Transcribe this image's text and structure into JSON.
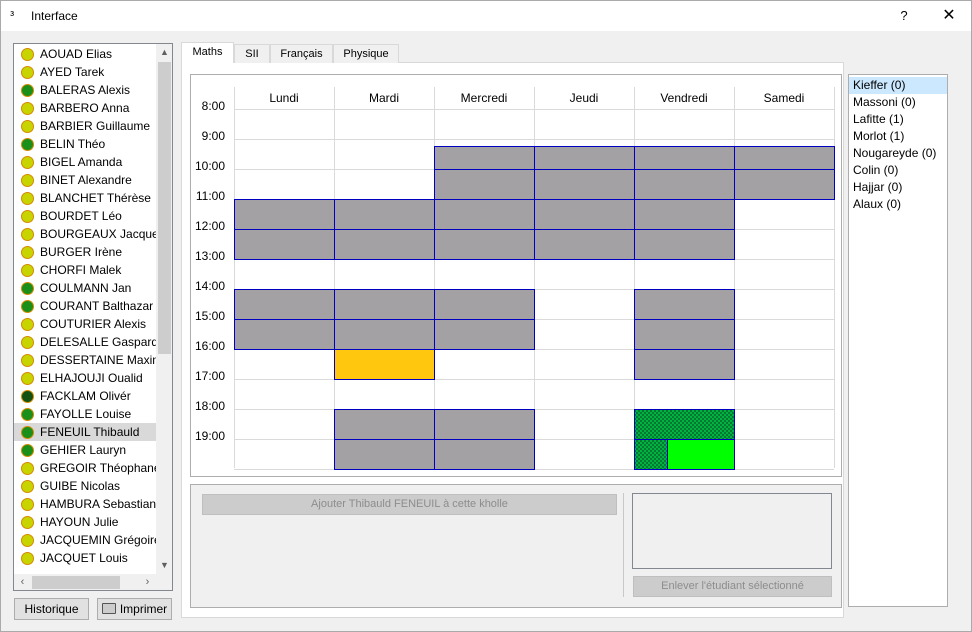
{
  "window": {
    "title": "Interface",
    "help": "?",
    "close": "✕",
    "app_icon": "app-icon"
  },
  "students": [
    {
      "name": "AOUAD Elias",
      "color": "#c8d400"
    },
    {
      "name": "AYED Tarek",
      "color": "#c8d400"
    },
    {
      "name": "BALERAS Alexis",
      "color": "#1a8f1a"
    },
    {
      "name": "BARBERO Anna",
      "color": "#c8d400"
    },
    {
      "name": "BARBIER Guillaume",
      "color": "#c8d400"
    },
    {
      "name": "BELIN Théo",
      "color": "#1a8f1a"
    },
    {
      "name": "BIGEL Amanda",
      "color": "#c8d400"
    },
    {
      "name": "BINET Alexandre",
      "color": "#c8d400"
    },
    {
      "name": "BLANCHET Thérèse",
      "color": "#c8d400"
    },
    {
      "name": "BOURDET Léo",
      "color": "#c8d400"
    },
    {
      "name": "BOURGEAUX Jacques",
      "color": "#c8d400"
    },
    {
      "name": "BURGER Irène",
      "color": "#c8d400"
    },
    {
      "name": "CHORFI Malek",
      "color": "#c8d400"
    },
    {
      "name": "COULMANN Jan",
      "color": "#1a8f1a"
    },
    {
      "name": "COURANT Balthazar",
      "color": "#1a8f1a"
    },
    {
      "name": "COUTURIER Alexis",
      "color": "#c8d400"
    },
    {
      "name": "DELESALLE Gaspard",
      "color": "#c8d400"
    },
    {
      "name": "DESSERTAINE Maxime",
      "color": "#c8d400"
    },
    {
      "name": "ELHAJOUJI Oualid",
      "color": "#c8d400"
    },
    {
      "name": "FACKLAM Olivér",
      "color": "#145214"
    },
    {
      "name": "FAYOLLE Louise",
      "color": "#1a8f1a"
    },
    {
      "name": "FENEUIL Thibauld",
      "color": "#1a8f1a",
      "selected": true
    },
    {
      "name": "GEHIER Lauryn",
      "color": "#1a8f1a"
    },
    {
      "name": "GREGOIR Théophane",
      "color": "#c8d400"
    },
    {
      "name": "GUIBE Nicolas",
      "color": "#c8d400"
    },
    {
      "name": "HAMBURA Sebastian",
      "color": "#c8d400"
    },
    {
      "name": "HAYOUN Julie",
      "color": "#c8d400"
    },
    {
      "name": "JACQUEMIN Grégoire",
      "color": "#c8d400"
    },
    {
      "name": "JACQUET Louis",
      "color": "#c8d400"
    }
  ],
  "buttons": {
    "historique": "Historique",
    "imprimer": "Imprimer"
  },
  "tabs": [
    {
      "label": "Maths",
      "active": true
    },
    {
      "label": "SII"
    },
    {
      "label": "Français"
    },
    {
      "label": "Physique"
    }
  ],
  "schedule": {
    "days": [
      "Lundi",
      "Mardi",
      "Mercredi",
      "Jeudi",
      "Vendredi",
      "Samedi"
    ],
    "hours": [
      "8:00",
      "9:00",
      "10:00",
      "11:00",
      "12:00",
      "13:00",
      "14:00",
      "15:00",
      "16:00",
      "17:00",
      "18:00",
      "19:00"
    ],
    "slots": [
      {
        "day": 2,
        "start": "9:00",
        "end": "10:00",
        "state": "taken"
      },
      {
        "day": 2,
        "start": "10:00",
        "end": "11:00",
        "state": "taken"
      },
      {
        "day": 3,
        "start": "9:00",
        "end": "10:00",
        "state": "taken"
      },
      {
        "day": 3,
        "start": "10:00",
        "end": "11:00",
        "state": "taken"
      },
      {
        "day": 4,
        "start": "9:00",
        "end": "10:00",
        "state": "taken"
      },
      {
        "day": 4,
        "start": "10:00",
        "end": "11:00",
        "state": "taken"
      },
      {
        "day": 5,
        "start": "9:00",
        "end": "10:00",
        "state": "taken"
      },
      {
        "day": 5,
        "start": "10:00",
        "end": "11:00",
        "state": "taken"
      },
      {
        "day": 0,
        "start": "11:00",
        "end": "12:00",
        "state": "taken"
      },
      {
        "day": 0,
        "start": "12:00",
        "end": "13:00",
        "state": "taken"
      },
      {
        "day": 1,
        "start": "11:00",
        "end": "12:00",
        "state": "taken"
      },
      {
        "day": 1,
        "start": "12:00",
        "end": "13:00",
        "state": "taken"
      },
      {
        "day": 2,
        "start": "11:00",
        "end": "12:00",
        "state": "taken"
      },
      {
        "day": 2,
        "start": "12:00",
        "end": "13:00",
        "state": "taken"
      },
      {
        "day": 3,
        "start": "11:00",
        "end": "12:00",
        "state": "taken"
      },
      {
        "day": 3,
        "start": "12:00",
        "end": "13:00",
        "state": "taken"
      },
      {
        "day": 4,
        "start": "11:00",
        "end": "12:00",
        "state": "taken"
      },
      {
        "day": 4,
        "start": "12:00",
        "end": "13:00",
        "state": "taken"
      },
      {
        "day": 0,
        "start": "14:00",
        "end": "15:00",
        "state": "taken"
      },
      {
        "day": 0,
        "start": "15:00",
        "end": "16:00",
        "state": "taken"
      },
      {
        "day": 1,
        "start": "14:00",
        "end": "15:00",
        "state": "taken"
      },
      {
        "day": 1,
        "start": "15:00",
        "end": "16:00",
        "state": "taken"
      },
      {
        "day": 2,
        "start": "14:00",
        "end": "15:00",
        "state": "taken"
      },
      {
        "day": 2,
        "start": "15:00",
        "end": "16:00",
        "state": "taken"
      },
      {
        "day": 4,
        "start": "14:00",
        "end": "15:00",
        "state": "taken"
      },
      {
        "day": 4,
        "start": "15:00",
        "end": "16:00",
        "state": "taken"
      },
      {
        "day": 4,
        "start": "16:00",
        "end": "17:00",
        "state": "taken"
      },
      {
        "day": 1,
        "start": "16:00",
        "end": "17:00",
        "state": "highlighted"
      },
      {
        "day": 1,
        "start": "18:00",
        "end": "19:00",
        "state": "taken"
      },
      {
        "day": 1,
        "start": "19:00",
        "end": "20:00",
        "state": "taken"
      },
      {
        "day": 2,
        "start": "18:00",
        "end": "19:00",
        "state": "taken"
      },
      {
        "day": 2,
        "start": "19:00",
        "end": "20:00",
        "state": "taken"
      },
      {
        "day": 4,
        "start": "18:00",
        "end": "19:00",
        "state": "assigned-hatched"
      },
      {
        "day": 4,
        "start": "19:00",
        "end": "20:00",
        "state": "assigned-hatched",
        "part": "left"
      },
      {
        "day": 4,
        "start": "19:00",
        "end": "20:00",
        "state": "assigned",
        "part": "right"
      }
    ],
    "colors": {
      "taken": "#a3a1a4",
      "highlighted": "#ffc70e",
      "assigned": "#00ff00",
      "assigned-hatched": "#00c040",
      "border": "#0000c0"
    }
  },
  "actions": {
    "add_label": "Ajouter Thibauld FENEUIL à cette kholle",
    "remove_label": "Enlever l'étudiant sélectionné"
  },
  "examiners": [
    {
      "label": "Kieffer (0)",
      "selected": true
    },
    {
      "label": "Massoni (0)"
    },
    {
      "label": "Lafitte (1)"
    },
    {
      "label": "Morlot (1)"
    },
    {
      "label": "Nougareyde (0)"
    },
    {
      "label": "Colin (0)"
    },
    {
      "label": "Hajjar (0)"
    },
    {
      "label": "Alaux (0)"
    }
  ]
}
